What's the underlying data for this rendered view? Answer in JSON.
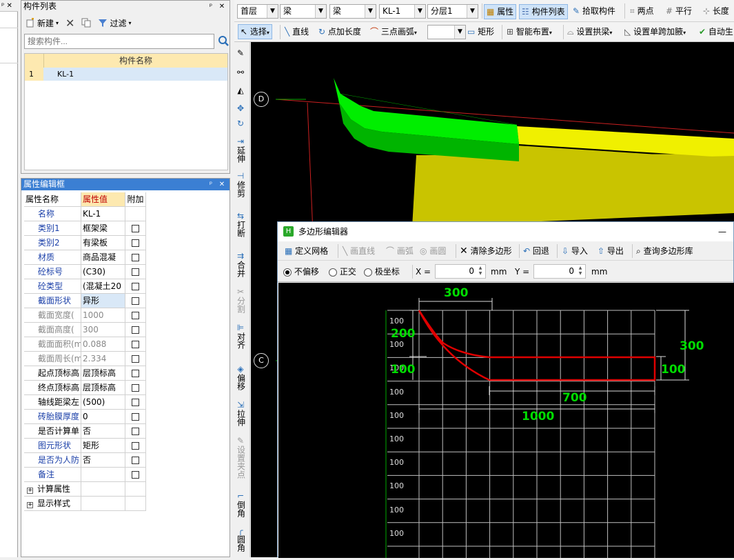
{
  "left_strip": {
    "pin": "ᵖ",
    "close": "✕"
  },
  "component_list": {
    "title": "构件列表",
    "new_label": "新建",
    "filter_label": "过滤",
    "search_placeholder": "搜索构件...",
    "column_header": "构件名称",
    "rows": [
      {
        "index": "1",
        "name": "KL-1"
      }
    ]
  },
  "properties": {
    "title": "属性编辑框",
    "headers": {
      "name": "属性名称",
      "value": "属性值",
      "extra": "附加"
    },
    "rows": [
      {
        "name": "名称",
        "value": "KL-1",
        "style": "blue",
        "check": false
      },
      {
        "name": "类别1",
        "value": "框架梁",
        "style": "blue",
        "check": true
      },
      {
        "name": "类别2",
        "value": "有梁板",
        "style": "blue",
        "check": true
      },
      {
        "name": "材质",
        "value": "商品混凝",
        "style": "blue",
        "check": true
      },
      {
        "name": "砼标号",
        "value": "(C30)",
        "style": "blue",
        "check": true
      },
      {
        "name": "砼类型",
        "value": "(混凝土20",
        "style": "blue",
        "check": true
      },
      {
        "name": "截面形状",
        "value": "异形",
        "style": "blue",
        "check": true,
        "highlight": true
      },
      {
        "name": "截面宽度(",
        "value": "1000",
        "style": "gray",
        "check": true
      },
      {
        "name": "截面高度(",
        "value": "300",
        "style": "gray",
        "check": true
      },
      {
        "name": "截面面积(m",
        "value": "0.088",
        "style": "gray",
        "check": true
      },
      {
        "name": "截面周长(m",
        "value": "2.334",
        "style": "gray",
        "check": true
      },
      {
        "name": "起点顶标高",
        "value": "层顶标高",
        "style": "black",
        "check": true
      },
      {
        "name": "终点顶标高",
        "value": "层顶标高",
        "style": "black",
        "check": true
      },
      {
        "name": "轴线距梁左",
        "value": "(500)",
        "style": "black",
        "check": true
      },
      {
        "name": "砖胎膜厚度",
        "value": "0",
        "style": "blue",
        "check": true
      },
      {
        "name": "是否计算单",
        "value": "否",
        "style": "black",
        "check": true
      },
      {
        "name": "图元形状",
        "value": "矩形",
        "style": "blue",
        "check": true
      },
      {
        "name": "是否为人防",
        "value": "否",
        "style": "blue",
        "check": true
      },
      {
        "name": "备注",
        "value": "",
        "style": "blue",
        "check": true
      }
    ],
    "groups": [
      "计算属性",
      "显示样式"
    ]
  },
  "toolbar1": {
    "floor": "首层",
    "type1": "梁",
    "type2": "梁",
    "component": "KL-1",
    "layer": "分层1",
    "attr_label": "属性",
    "list_label": "构件列表",
    "pick_label": "拾取构件",
    "two_point": "两点",
    "parallel": "平行",
    "length": "长度"
  },
  "toolbar2": {
    "select": "选择",
    "line": "直线",
    "point_len": "点加长度",
    "arc3": "三点画弧",
    "rect": "矩形",
    "smart": "智能布置",
    "arch": "设置拱梁",
    "haunch": "设置单跨加腋",
    "auto": "自动生"
  },
  "vertical_toolbar": [
    "延伸",
    "修剪",
    "打断",
    "合并",
    "分割",
    "对齐",
    "偏移",
    "拉伸",
    "设置夹点",
    "倒角",
    "圆角"
  ],
  "canvas": {
    "axis_d": "D",
    "axis_c": "C"
  },
  "dialog": {
    "title": "多边形编辑器",
    "minimize": "—",
    "tools": {
      "grid": "定义网格",
      "line": "画直线",
      "arc": "画弧",
      "circle": "画圆",
      "clear": "清除多边形",
      "undo": "回退",
      "import": "导入",
      "export": "导出",
      "query": "查询多边形库"
    },
    "offset_options": {
      "none": "不偏移",
      "ortho": "正交",
      "polar": "极坐标"
    },
    "x_label": "X =",
    "x_value": "0",
    "y_label": "Y =",
    "y_value": "0",
    "unit": "mm",
    "grid_row_labels": [
      "100",
      "100",
      "100",
      "100",
      "100",
      "100",
      "100",
      "100",
      "100",
      "100"
    ],
    "dims": {
      "top": "300",
      "left": "200",
      "left2": "100",
      "right_total": "300",
      "right": "100",
      "bottom": "700",
      "bottom_total": "1000"
    }
  },
  "colors": {
    "title_active": "#3b7fd3",
    "green_dim": "#00dd00",
    "shape": "#e00000"
  }
}
